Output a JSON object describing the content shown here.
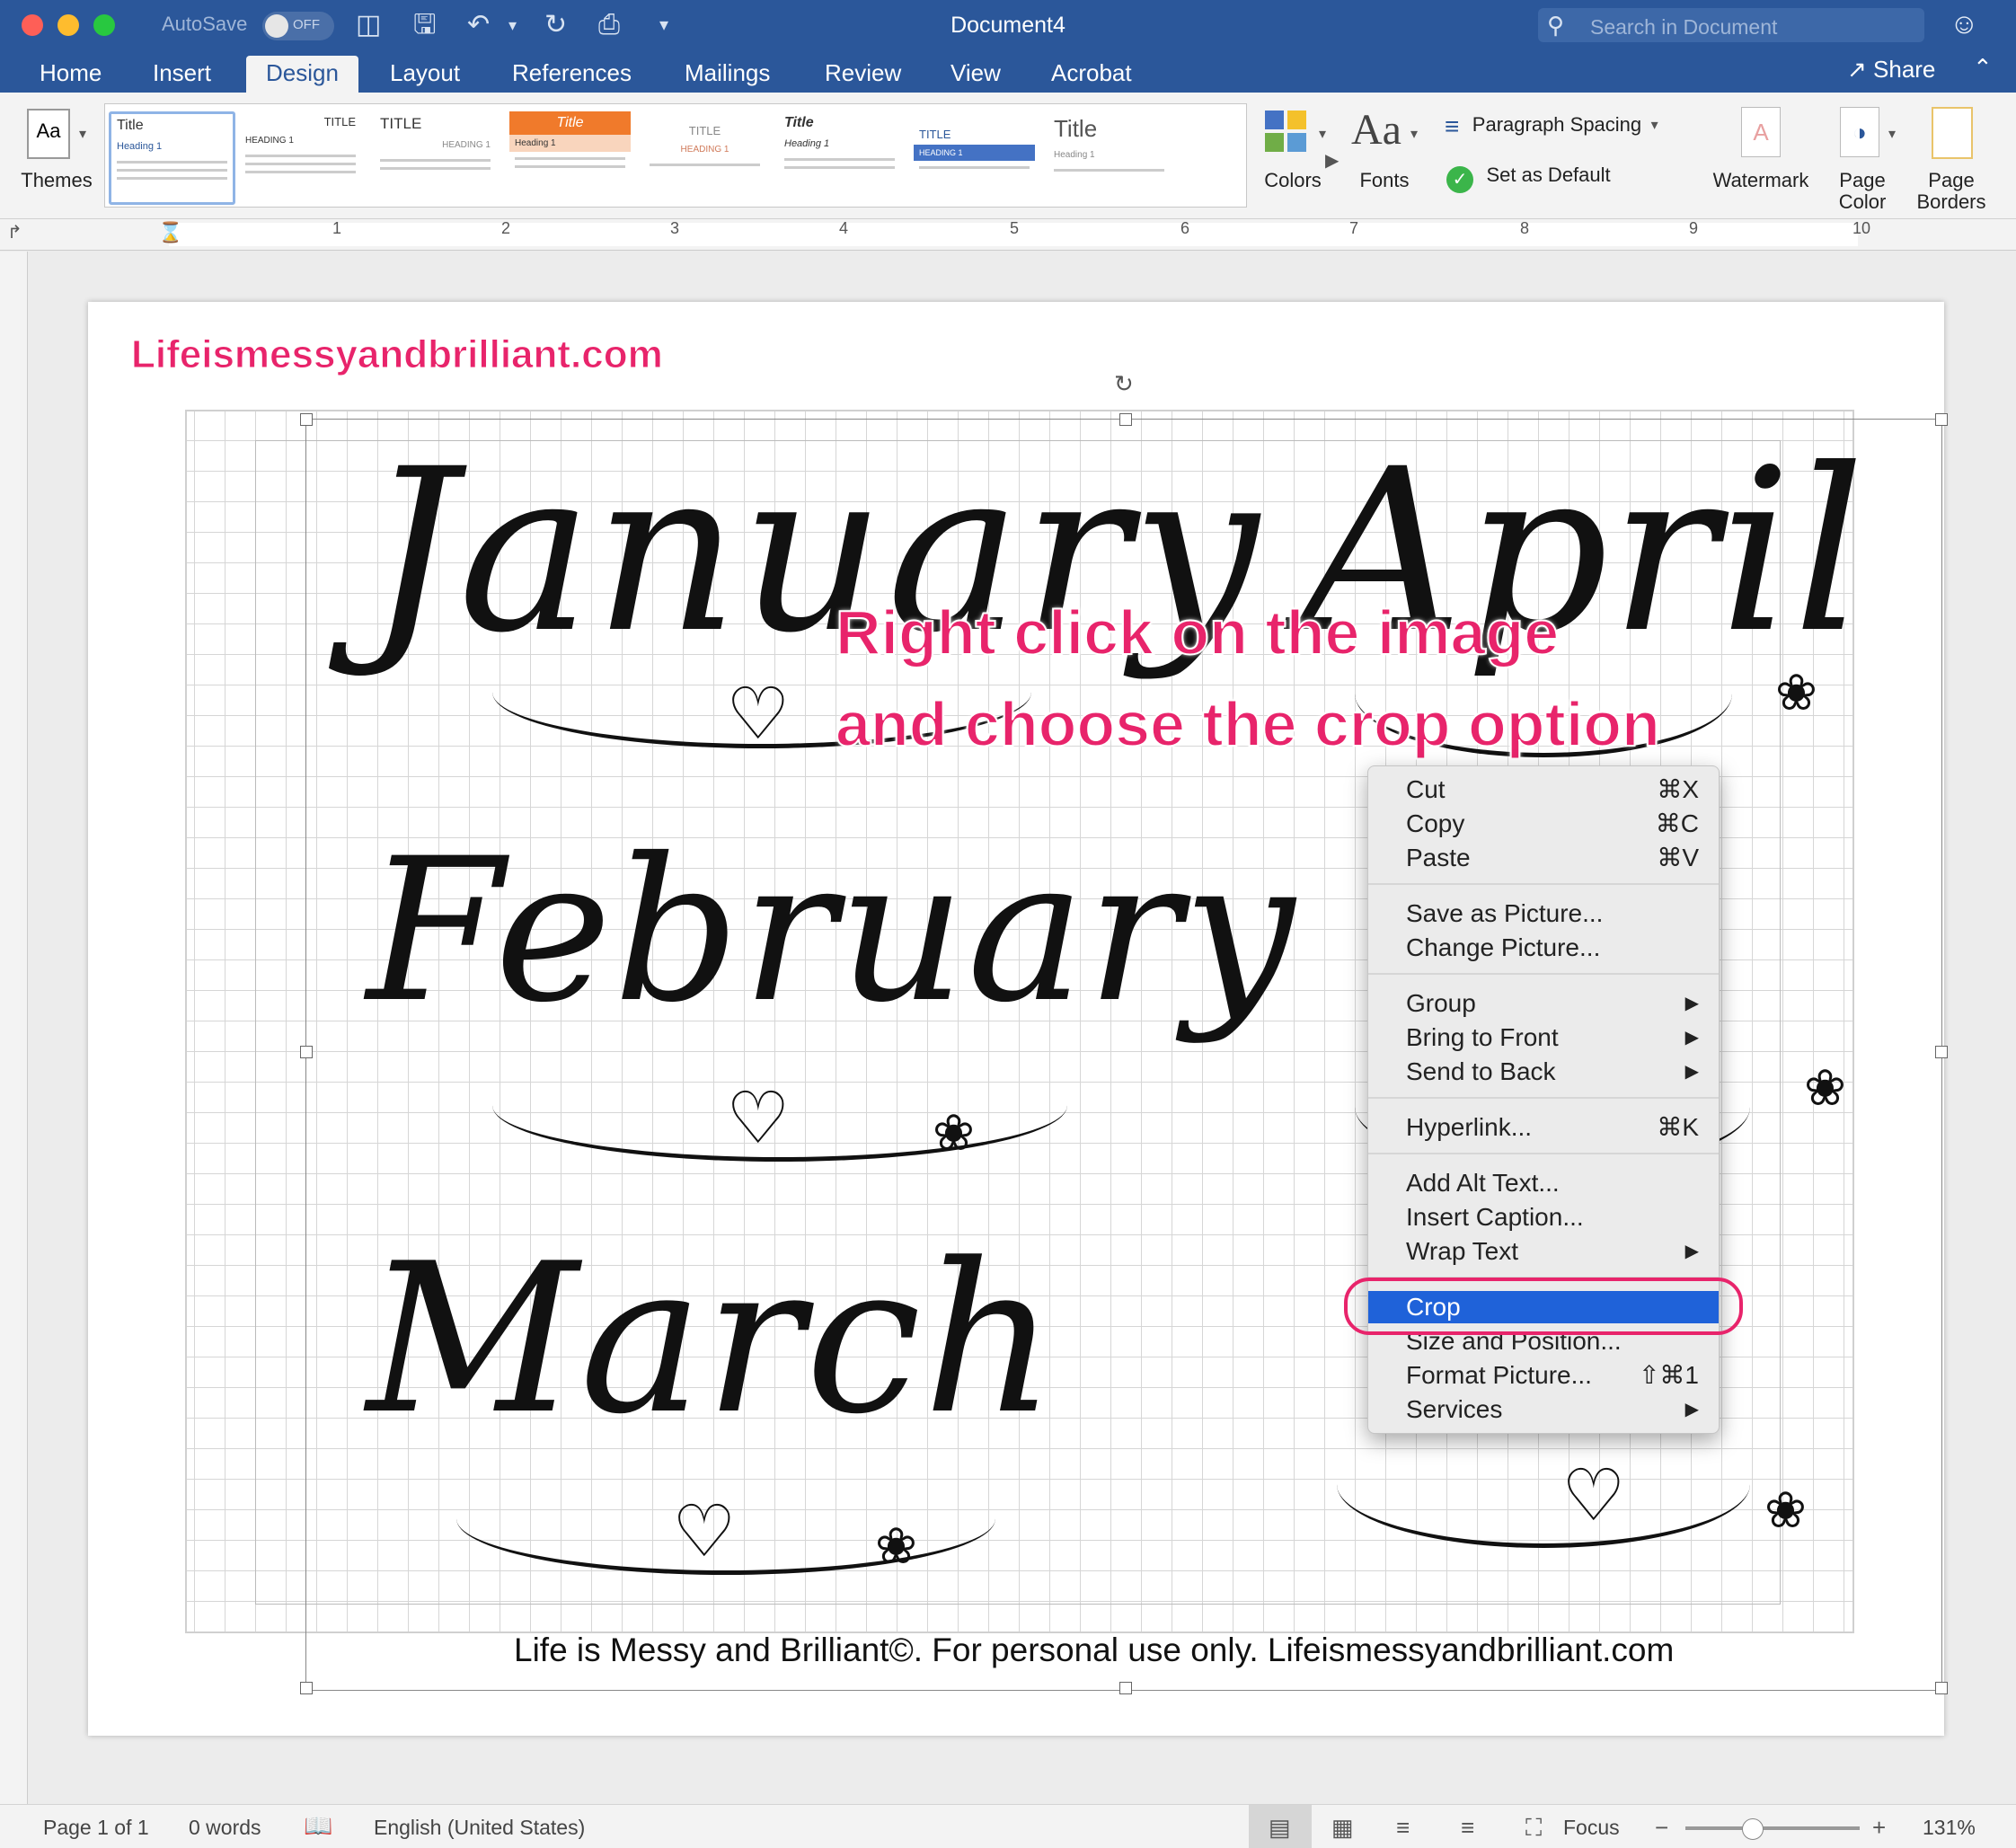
{
  "window": {
    "title": "Document4",
    "autosave_label": "AutoSave",
    "autosave_state": "OFF",
    "search_placeholder": "Search in Document",
    "share_label": "Share"
  },
  "tabs": [
    {
      "label": "Home"
    },
    {
      "label": "Insert"
    },
    {
      "label": "Design",
      "active": true
    },
    {
      "label": "Layout"
    },
    {
      "label": "References"
    },
    {
      "label": "Mailings"
    },
    {
      "label": "Review"
    },
    {
      "label": "View"
    },
    {
      "label": "Acrobat"
    }
  ],
  "ribbon": {
    "themes_label": "Themes",
    "gallery": [
      {
        "title": "Title",
        "heading": "Heading 1"
      },
      {
        "title": "TITLE",
        "heading": "HEADING 1"
      },
      {
        "title": "TITLE",
        "heading": "HEADING 1"
      },
      {
        "title": "Title",
        "heading": "Heading 1"
      },
      {
        "title": "TITLE",
        "heading": "HEADING 1"
      },
      {
        "title": "Title",
        "heading": "Heading 1"
      },
      {
        "title": "TITLE",
        "heading": "HEADING 1"
      },
      {
        "title": "Title",
        "heading": "Heading 1"
      }
    ],
    "colors_label": "Colors",
    "fonts_label": "Fonts",
    "paragraph_spacing_label": "Paragraph Spacing",
    "set_default_label": "Set as Default",
    "watermark_label": "Watermark",
    "page_color_label": "Page Color",
    "page_borders_label": "Page Borders"
  },
  "ruler": {
    "numbers": [
      "1",
      "2",
      "3",
      "4",
      "5",
      "6",
      "7",
      "8",
      "9",
      "10"
    ]
  },
  "document": {
    "site_name": "Lifeismessyandbrilliant.com",
    "months": [
      "January",
      "February",
      "March",
      "April"
    ],
    "instruction_line1": "Right click on the image",
    "instruction_line2": "and choose the crop option",
    "footer_note": "Life is Messy and Brilliant©. For personal use only. Lifeismessyandbrilliant.com"
  },
  "context_menu": {
    "items": [
      {
        "label": "Cut",
        "shortcut": "⌘X"
      },
      {
        "label": "Copy",
        "shortcut": "⌘C"
      },
      {
        "label": "Paste",
        "shortcut": "⌘V"
      },
      {
        "label": "Save as Picture..."
      },
      {
        "label": "Change Picture..."
      },
      {
        "label": "Group",
        "submenu": true
      },
      {
        "label": "Bring to Front",
        "submenu": true
      },
      {
        "label": "Send to Back",
        "submenu": true
      },
      {
        "label": "Hyperlink...",
        "shortcut": "⌘K"
      },
      {
        "label": "Add Alt Text..."
      },
      {
        "label": "Insert Caption..."
      },
      {
        "label": "Wrap Text",
        "submenu": true
      },
      {
        "label": "Crop",
        "highlighted": true
      },
      {
        "label": "Size and Position..."
      },
      {
        "label": "Format Picture...",
        "shortcut": "⇧⌘1"
      },
      {
        "label": "Services",
        "submenu": true
      }
    ],
    "submenu_arrow": "▶"
  },
  "status": {
    "page": "Page 1 of 1",
    "words": "0 words",
    "language": "English (United States)",
    "focus_label": "Focus",
    "zoom": "131%",
    "zoom_fraction": 0.38
  },
  "colors": {
    "word_blue": "#2b579a",
    "accent_pink": "#e8246b",
    "menu_highlight": "#1f62d9"
  }
}
